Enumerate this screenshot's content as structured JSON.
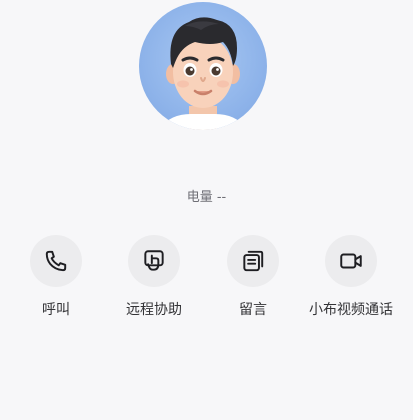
{
  "profile": {
    "avatar_icon": "memoji-boy-avatar",
    "battery_text": "电量 --"
  },
  "actions": [
    {
      "id": "call",
      "label": "呼叫",
      "icon": "phone-icon"
    },
    {
      "id": "remote-assist",
      "label": "远程协助",
      "icon": "remote-assist-icon"
    },
    {
      "id": "message",
      "label": "留言",
      "icon": "message-note-icon"
    },
    {
      "id": "video-call",
      "label": "小布视频通话",
      "icon": "video-camera-icon"
    }
  ],
  "colors": {
    "background": "#f7f7f9",
    "avatar_bg": "#8fb4ea",
    "action_circle": "#ececee",
    "icon_stroke": "#1e1e22",
    "label_text": "#333336",
    "secondary_text": "#6f6f76"
  }
}
